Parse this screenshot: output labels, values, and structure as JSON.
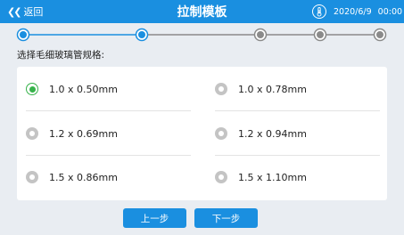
{
  "header": {
    "back_label": "返回",
    "back_icon": "chevron-double-left-icon",
    "title": "拉制模板",
    "temperature_icon": "thermometer-icon",
    "date": "2020/6/9",
    "time": "00:00",
    "background_color": "#1a8fe0"
  },
  "stepper": {
    "total_steps": 5,
    "current_step": 2,
    "active_color": "#1a8fe0",
    "inactive_color": "#8a8a8a"
  },
  "form": {
    "label": "选择毛细玻璃管规格:",
    "selected_index": 0,
    "options": [
      {
        "label": "1.0 x 0.50mm"
      },
      {
        "label": "1.0 x 0.78mm"
      },
      {
        "label": "1.2 x 0.69mm"
      },
      {
        "label": "1.2 x 0.94mm"
      },
      {
        "label": "1.5 x 0.86mm"
      },
      {
        "label": "1.5 x 1.10mm"
      }
    ],
    "selected_color": "#36b24a"
  },
  "buttons": {
    "prev_label": "上一步",
    "next_label": "下一步"
  }
}
